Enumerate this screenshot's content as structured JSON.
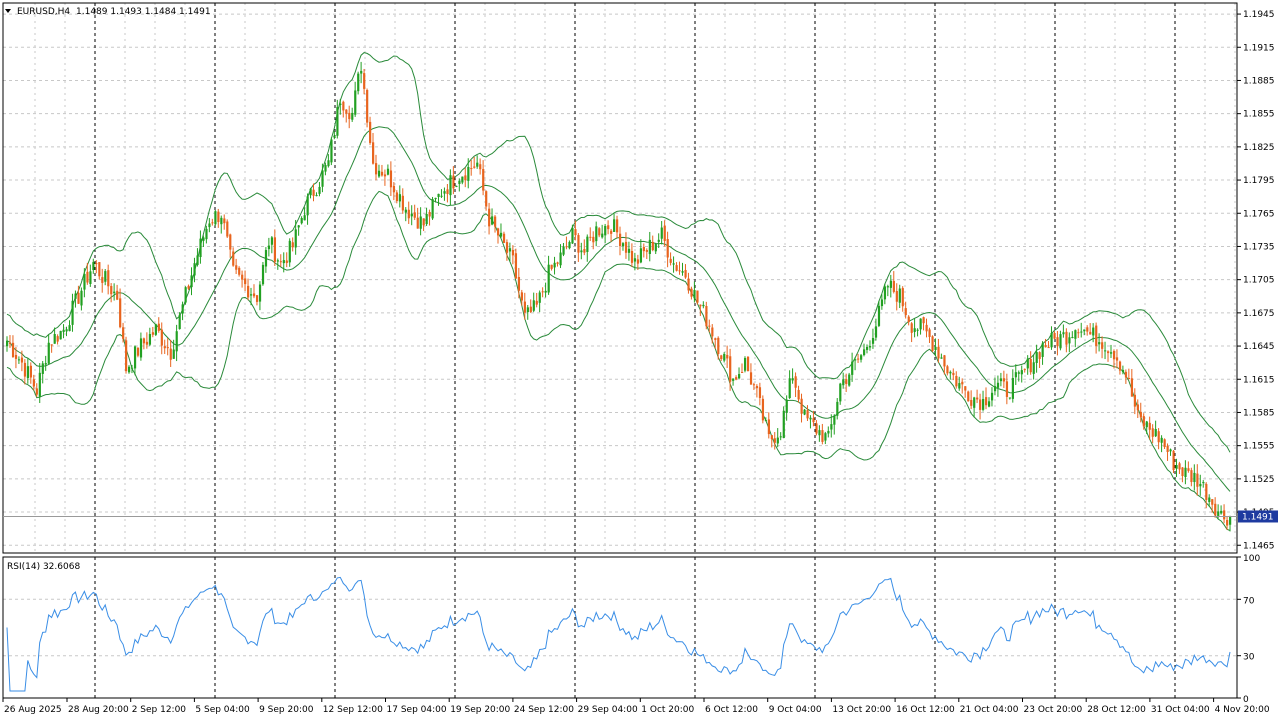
{
  "header": {
    "symbol_timeframe": "EURUSD,H4",
    "ohlc": "1.1489 1.1493 1.1484 1.1491",
    "menu_arrow_icon": "triangle-down-icon"
  },
  "rsi_panel": {
    "label": "RSI(14) 32.6068"
  },
  "colors": {
    "bull": "#22a022",
    "bear": "#e8641e",
    "bands": "#2a8a3a",
    "rsi": "#3a8ee6",
    "grid": "#c8c8c8",
    "vline": "#000000",
    "price_tag_bg": "#1e3aa0",
    "price_tag_text": "#ffffff",
    "axis": "#000000"
  },
  "chart_data": [
    {
      "type": "candlestick",
      "title": "EURUSD,H4",
      "ylim": [
        1.1458,
        1.1955
      ],
      "y_ticks": [
        "1.1945",
        "1.1915",
        "1.1885",
        "1.1855",
        "1.1825",
        "1.1795",
        "1.1765",
        "1.1735",
        "1.1705",
        "1.1675",
        "1.1645",
        "1.1615",
        "1.1585",
        "1.1555",
        "1.1525",
        "1.1495",
        "1.1465"
      ],
      "current_price": "1.1491",
      "grid": true,
      "indicator": "Bollinger Bands",
      "close_anchors": [
        [
          0,
          1.165
        ],
        [
          5,
          1.163
        ],
        [
          10,
          1.1605
        ],
        [
          14,
          1.1648
        ],
        [
          19,
          1.166
        ],
        [
          24,
          1.169
        ],
        [
          29,
          1.172
        ],
        [
          34,
          1.17
        ],
        [
          37,
          1.169
        ],
        [
          40,
          1.1625
        ],
        [
          45,
          1.1645
        ],
        [
          50,
          1.166
        ],
        [
          55,
          1.164
        ],
        [
          59,
          1.168
        ],
        [
          63,
          1.172
        ],
        [
          68,
          1.176
        ],
        [
          72,
          1.1765
        ],
        [
          76,
          1.171
        ],
        [
          80,
          1.17
        ],
        [
          84,
          1.169
        ],
        [
          88,
          1.174
        ],
        [
          92,
          1.172
        ],
        [
          96,
          1.1735
        ],
        [
          100,
          1.177
        ],
        [
          104,
          1.179
        ],
        [
          108,
          1.181
        ],
        [
          112,
          1.187
        ],
        [
          116,
          1.1855
        ],
        [
          119,
          1.19
        ],
        [
          123,
          1.181
        ],
        [
          128,
          1.18
        ],
        [
          134,
          1.177
        ],
        [
          140,
          1.1755
        ],
        [
          146,
          1.1785
        ],
        [
          152,
          1.18
        ],
        [
          158,
          1.181
        ],
        [
          162,
          1.176
        ],
        [
          166,
          1.174
        ],
        [
          170,
          1.172
        ],
        [
          174,
          1.167
        ],
        [
          178,
          1.168
        ],
        [
          182,
          1.171
        ],
        [
          186,
          1.1725
        ],
        [
          190,
          1.1745
        ],
        [
          194,
          1.173
        ],
        [
          198,
          1.175
        ],
        [
          203,
          1.1755
        ],
        [
          207,
          1.174
        ],
        [
          211,
          1.172
        ],
        [
          216,
          1.1735
        ],
        [
          220,
          1.1745
        ],
        [
          224,
          1.172
        ],
        [
          228,
          1.171
        ],
        [
          232,
          1.1685
        ],
        [
          236,
          1.1665
        ],
        [
          240,
          1.164
        ],
        [
          244,
          1.1615
        ],
        [
          248,
          1.163
        ],
        [
          252,
          1.16
        ],
        [
          256,
          1.156
        ],
        [
          260,
          1.157
        ],
        [
          264,
          1.162
        ],
        [
          268,
          1.158
        ],
        [
          272,
          1.157
        ],
        [
          276,
          1.156
        ],
        [
          280,
          1.161
        ],
        [
          284,
          1.1625
        ],
        [
          288,
          1.164
        ],
        [
          292,
          1.1665
        ],
        [
          296,
          1.17
        ],
        [
          300,
          1.169
        ],
        [
          304,
          1.1665
        ],
        [
          308,
          1.166
        ],
        [
          312,
          1.1645
        ],
        [
          316,
          1.1625
        ],
        [
          320,
          1.161
        ],
        [
          324,
          1.16
        ],
        [
          328,
          1.1595
        ],
        [
          332,
          1.161
        ],
        [
          336,
          1.1605
        ],
        [
          340,
          1.1615
        ],
        [
          344,
          1.163
        ],
        [
          348,
          1.1645
        ],
        [
          352,
          1.165
        ],
        [
          356,
          1.1655
        ],
        [
          360,
          1.1665
        ],
        [
          364,
          1.1655
        ],
        [
          368,
          1.165
        ],
        [
          372,
          1.164
        ],
        [
          376,
          1.162
        ],
        [
          380,
          1.158
        ],
        [
          384,
          1.157
        ],
        [
          388,
          1.156
        ],
        [
          392,
          1.154
        ],
        [
          396,
          1.153
        ],
        [
          400,
          1.1525
        ],
        [
          404,
          1.151
        ],
        [
          408,
          1.1492
        ],
        [
          411,
          1.1491
        ]
      ]
    },
    {
      "type": "line",
      "title": "RSI(14) 32.6068",
      "ylim": [
        0,
        100
      ],
      "y_ticks": [
        "100",
        "70",
        "30",
        "0"
      ],
      "levels": [
        70,
        30
      ],
      "current_value": 32.6068
    }
  ],
  "x_axis": {
    "labels": [
      "26 Aug 2025",
      "28 Aug 20:00",
      "2 Sep 12:00",
      "5 Sep 04:00",
      "9 Sep 20:00",
      "12 Sep 12:00",
      "17 Sep 04:00",
      "19 Sep 20:00",
      "24 Sep 12:00",
      "29 Sep 04:00",
      "1 Oct 20:00",
      "6 Oct 12:00",
      "9 Oct 04:00",
      "13 Oct 20:00",
      "16 Oct 12:00",
      "21 Oct 04:00",
      "23 Oct 20:00",
      "28 Oct 12:00",
      "31 Oct 04:00",
      "4 Nov 20:00"
    ]
  }
}
